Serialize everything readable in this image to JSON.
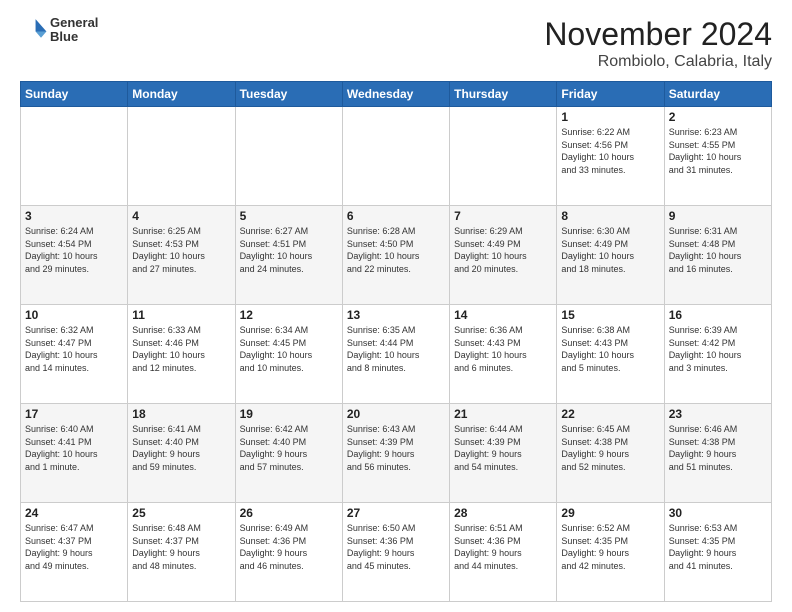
{
  "header": {
    "logo_line1": "General",
    "logo_line2": "Blue",
    "month": "November 2024",
    "location": "Rombiolo, Calabria, Italy"
  },
  "weekdays": [
    "Sunday",
    "Monday",
    "Tuesday",
    "Wednesday",
    "Thursday",
    "Friday",
    "Saturday"
  ],
  "weeks": [
    [
      {
        "day": "",
        "info": ""
      },
      {
        "day": "",
        "info": ""
      },
      {
        "day": "",
        "info": ""
      },
      {
        "day": "",
        "info": ""
      },
      {
        "day": "",
        "info": ""
      },
      {
        "day": "1",
        "info": "Sunrise: 6:22 AM\nSunset: 4:56 PM\nDaylight: 10 hours\nand 33 minutes."
      },
      {
        "day": "2",
        "info": "Sunrise: 6:23 AM\nSunset: 4:55 PM\nDaylight: 10 hours\nand 31 minutes."
      }
    ],
    [
      {
        "day": "3",
        "info": "Sunrise: 6:24 AM\nSunset: 4:54 PM\nDaylight: 10 hours\nand 29 minutes."
      },
      {
        "day": "4",
        "info": "Sunrise: 6:25 AM\nSunset: 4:53 PM\nDaylight: 10 hours\nand 27 minutes."
      },
      {
        "day": "5",
        "info": "Sunrise: 6:27 AM\nSunset: 4:51 PM\nDaylight: 10 hours\nand 24 minutes."
      },
      {
        "day": "6",
        "info": "Sunrise: 6:28 AM\nSunset: 4:50 PM\nDaylight: 10 hours\nand 22 minutes."
      },
      {
        "day": "7",
        "info": "Sunrise: 6:29 AM\nSunset: 4:49 PM\nDaylight: 10 hours\nand 20 minutes."
      },
      {
        "day": "8",
        "info": "Sunrise: 6:30 AM\nSunset: 4:49 PM\nDaylight: 10 hours\nand 18 minutes."
      },
      {
        "day": "9",
        "info": "Sunrise: 6:31 AM\nSunset: 4:48 PM\nDaylight: 10 hours\nand 16 minutes."
      }
    ],
    [
      {
        "day": "10",
        "info": "Sunrise: 6:32 AM\nSunset: 4:47 PM\nDaylight: 10 hours\nand 14 minutes."
      },
      {
        "day": "11",
        "info": "Sunrise: 6:33 AM\nSunset: 4:46 PM\nDaylight: 10 hours\nand 12 minutes."
      },
      {
        "day": "12",
        "info": "Sunrise: 6:34 AM\nSunset: 4:45 PM\nDaylight: 10 hours\nand 10 minutes."
      },
      {
        "day": "13",
        "info": "Sunrise: 6:35 AM\nSunset: 4:44 PM\nDaylight: 10 hours\nand 8 minutes."
      },
      {
        "day": "14",
        "info": "Sunrise: 6:36 AM\nSunset: 4:43 PM\nDaylight: 10 hours\nand 6 minutes."
      },
      {
        "day": "15",
        "info": "Sunrise: 6:38 AM\nSunset: 4:43 PM\nDaylight: 10 hours\nand 5 minutes."
      },
      {
        "day": "16",
        "info": "Sunrise: 6:39 AM\nSunset: 4:42 PM\nDaylight: 10 hours\nand 3 minutes."
      }
    ],
    [
      {
        "day": "17",
        "info": "Sunrise: 6:40 AM\nSunset: 4:41 PM\nDaylight: 10 hours\nand 1 minute."
      },
      {
        "day": "18",
        "info": "Sunrise: 6:41 AM\nSunset: 4:40 PM\nDaylight: 9 hours\nand 59 minutes."
      },
      {
        "day": "19",
        "info": "Sunrise: 6:42 AM\nSunset: 4:40 PM\nDaylight: 9 hours\nand 57 minutes."
      },
      {
        "day": "20",
        "info": "Sunrise: 6:43 AM\nSunset: 4:39 PM\nDaylight: 9 hours\nand 56 minutes."
      },
      {
        "day": "21",
        "info": "Sunrise: 6:44 AM\nSunset: 4:39 PM\nDaylight: 9 hours\nand 54 minutes."
      },
      {
        "day": "22",
        "info": "Sunrise: 6:45 AM\nSunset: 4:38 PM\nDaylight: 9 hours\nand 52 minutes."
      },
      {
        "day": "23",
        "info": "Sunrise: 6:46 AM\nSunset: 4:38 PM\nDaylight: 9 hours\nand 51 minutes."
      }
    ],
    [
      {
        "day": "24",
        "info": "Sunrise: 6:47 AM\nSunset: 4:37 PM\nDaylight: 9 hours\nand 49 minutes."
      },
      {
        "day": "25",
        "info": "Sunrise: 6:48 AM\nSunset: 4:37 PM\nDaylight: 9 hours\nand 48 minutes."
      },
      {
        "day": "26",
        "info": "Sunrise: 6:49 AM\nSunset: 4:36 PM\nDaylight: 9 hours\nand 46 minutes."
      },
      {
        "day": "27",
        "info": "Sunrise: 6:50 AM\nSunset: 4:36 PM\nDaylight: 9 hours\nand 45 minutes."
      },
      {
        "day": "28",
        "info": "Sunrise: 6:51 AM\nSunset: 4:36 PM\nDaylight: 9 hours\nand 44 minutes."
      },
      {
        "day": "29",
        "info": "Sunrise: 6:52 AM\nSunset: 4:35 PM\nDaylight: 9 hours\nand 42 minutes."
      },
      {
        "day": "30",
        "info": "Sunrise: 6:53 AM\nSunset: 4:35 PM\nDaylight: 9 hours\nand 41 minutes."
      }
    ]
  ]
}
